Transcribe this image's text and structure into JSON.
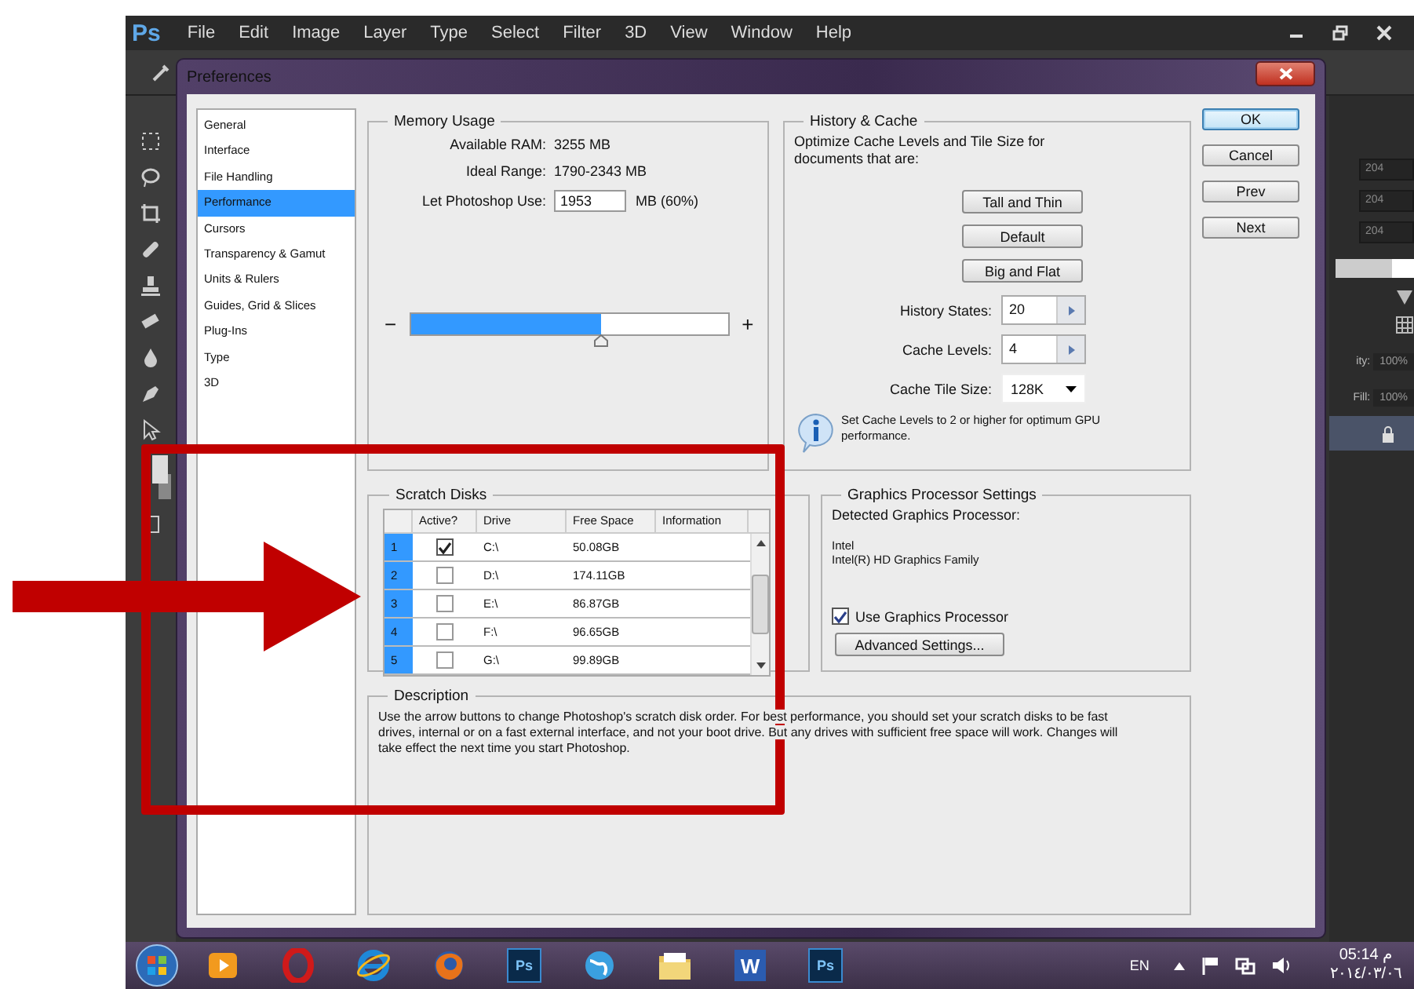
{
  "app": {
    "logo": "Ps",
    "menu": [
      "File",
      "Edit",
      "Image",
      "Layer",
      "Type",
      "Select",
      "Filter",
      "3D",
      "View",
      "Window",
      "Help"
    ]
  },
  "dialog": {
    "title": "Preferences",
    "sidebar": [
      {
        "label": "General",
        "selected": false
      },
      {
        "label": "Interface",
        "selected": false
      },
      {
        "label": "File Handling",
        "selected": false
      },
      {
        "label": "Performance",
        "selected": true
      },
      {
        "label": "Cursors",
        "selected": false
      },
      {
        "label": "Transparency & Gamut",
        "selected": false
      },
      {
        "label": "Units & Rulers",
        "selected": false
      },
      {
        "label": "Guides, Grid & Slices",
        "selected": false
      },
      {
        "label": "Plug-Ins",
        "selected": false
      },
      {
        "label": "Type",
        "selected": false
      },
      {
        "label": "3D",
        "selected": false
      }
    ],
    "memory": {
      "title": "Memory Usage",
      "available_label": "Available RAM:",
      "available": "3255 MB",
      "ideal_label": "Ideal Range:",
      "ideal": "1790-2343 MB",
      "use_label": "Let Photoshop Use:",
      "use_value": "1953",
      "use_unit": "MB (60%)",
      "minus": "−",
      "plus": "+",
      "level": 0.6
    },
    "history": {
      "title": "History & Cache",
      "intro": "Optimize Cache Levels and Tile Size for documents that are:",
      "presets": [
        "Tall and Thin",
        "Default",
        "Big and Flat"
      ],
      "fields": [
        {
          "label": "History States:",
          "value": "20",
          "kind": "stepper"
        },
        {
          "label": "Cache Levels:",
          "value": "4",
          "kind": "stepper"
        },
        {
          "label": "Cache Tile Size:",
          "value": "128K",
          "kind": "dropdown"
        }
      ],
      "note": "Set Cache Levels to 2 or higher for optimum GPU performance."
    },
    "buttons": [
      {
        "label": "OK",
        "default": true
      },
      {
        "label": "Cancel",
        "default": false
      },
      {
        "label": "Prev",
        "default": false
      },
      {
        "label": "Next",
        "default": false
      }
    ],
    "scratch": {
      "title": "Scratch Disks",
      "columns": [
        "Active?",
        "Drive",
        "Free Space",
        "Information"
      ],
      "rows": [
        {
          "index": "1",
          "active": true,
          "drive": "C:\\",
          "free": "50.08GB"
        },
        {
          "index": "2",
          "active": false,
          "drive": "D:\\",
          "free": "174.11GB"
        },
        {
          "index": "3",
          "active": false,
          "drive": "E:\\",
          "free": "86.87GB"
        },
        {
          "index": "4",
          "active": false,
          "drive": "F:\\",
          "free": "96.65GB"
        },
        {
          "index": "5",
          "active": false,
          "drive": "G:\\",
          "free": "99.89GB"
        }
      ]
    },
    "gpu": {
      "title": "Graphics Processor Settings",
      "detected_label": "Detected Graphics Processor:",
      "vendor": "Intel",
      "model": "Intel(R) HD Graphics Family",
      "use_label": "Use Graphics Processor",
      "use_checked": true,
      "advanced": "Advanced Settings..."
    },
    "description": {
      "title": "Description",
      "text": "Use the arrow buttons to change Photoshop's scratch disk order. For best performance, you should set your scratch disks to be fast drives, internal or on a fast external interface, and not your boot drive. But any drives with sufficient free space will work. Changes will take effect the next time you start Photoshop."
    }
  },
  "panels": {
    "fields": [
      "204",
      "204",
      "204"
    ],
    "opacity_label": "ity:",
    "opacity": "100%",
    "fill_label": "Fill:",
    "fill": "100%"
  },
  "taskbar": {
    "apps": [
      {
        "kind": "media"
      },
      {
        "kind": "opera"
      },
      {
        "kind": "ie"
      },
      {
        "kind": "firefox"
      },
      {
        "kind": "ps",
        "label": "Ps"
      },
      {
        "kind": "globe"
      },
      {
        "kind": "folder"
      },
      {
        "kind": "word",
        "label": "W"
      },
      {
        "kind": "ps",
        "label": "Ps"
      }
    ],
    "language": "EN",
    "time": "05:14 م",
    "date": "٢٠١٤/٠٣/٠٦"
  }
}
